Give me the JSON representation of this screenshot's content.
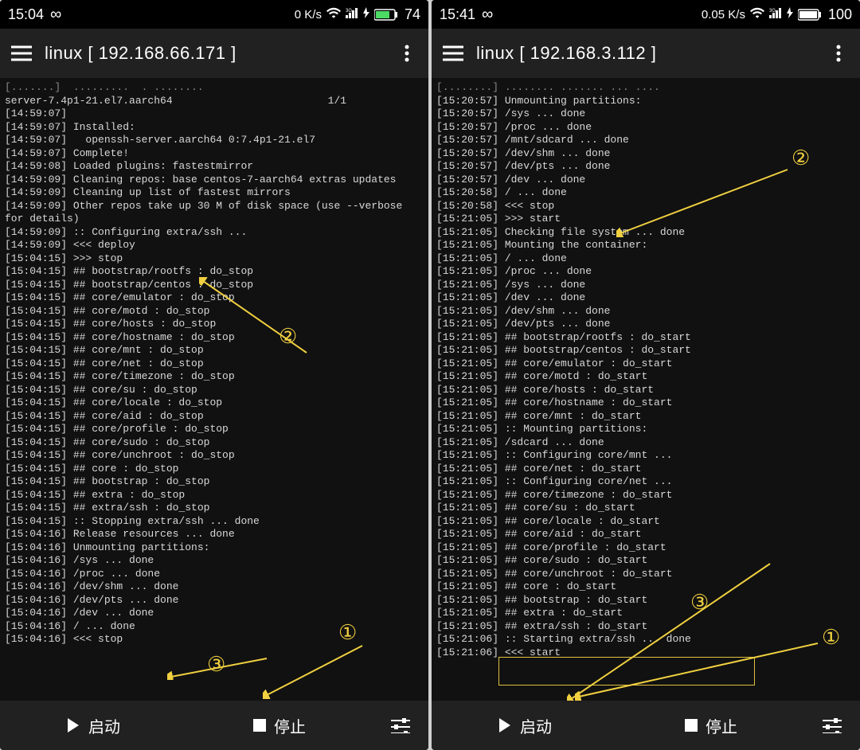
{
  "left": {
    "status": {
      "time": "15:04",
      "infinity": "∞",
      "speed": "0 K/s",
      "battery": "74"
    },
    "appbar": {
      "title": "linux  [ 192.168.66.171 ]"
    },
    "log": [
      "[.......]  .........  . ........",
      "server-7.4p1-21.el7.aarch64                         1/1",
      "[14:59:07]",
      "[14:59:07] Installed:",
      "[14:59:07]   openssh-server.aarch64 0:7.4p1-21.el7",
      "[14:59:07] Complete!",
      "[14:59:08] Loaded plugins: fastestmirror",
      "[14:59:09] Cleaning repos: base centos-7-aarch64 extras updates",
      "[14:59:09] Cleaning up list of fastest mirrors",
      "[14:59:09] Other repos take up 30 M of disk space (use --verbose for details)",
      "[14:59:09] :: Configuring extra/ssh ...",
      "[14:59:09] <<< deploy",
      "[15:04:15] >>> stop",
      "[15:04:15] ## bootstrap/rootfs : do_stop",
      "[15:04:15] ## bootstrap/centos : do_stop",
      "[15:04:15] ## core/emulator : do_stop",
      "[15:04:15] ## core/motd : do_stop",
      "[15:04:15] ## core/hosts : do_stop",
      "[15:04:15] ## core/hostname : do_stop",
      "[15:04:15] ## core/mnt : do_stop",
      "[15:04:15] ## core/net : do_stop",
      "[15:04:15] ## core/timezone : do_stop",
      "[15:04:15] ## core/su : do_stop",
      "[15:04:15] ## core/locale : do_stop",
      "[15:04:15] ## core/aid : do_stop",
      "[15:04:15] ## core/profile : do_stop",
      "[15:04:15] ## core/sudo : do_stop",
      "[15:04:15] ## core/unchroot : do_stop",
      "[15:04:15] ## core : do_stop",
      "[15:04:15] ## bootstrap : do_stop",
      "[15:04:15] ## extra : do_stop",
      "[15:04:15] ## extra/ssh : do_stop",
      "[15:04:15] :: Stopping extra/ssh ... done",
      "[15:04:16] Release resources ... done",
      "[15:04:16] Unmounting partitions:",
      "[15:04:16] /sys ... done",
      "[15:04:16] /proc ... done",
      "[15:04:16] /dev/shm ... done",
      "[15:04:16] /dev/pts ... done",
      "[15:04:16] /dev ... done",
      "[15:04:16] / ... done",
      "[15:04:16] <<< stop"
    ],
    "bottom": {
      "start": "启动",
      "stop": "停止"
    },
    "annot": {
      "n1": "①",
      "n2": "②",
      "n3": "③"
    }
  },
  "right": {
    "status": {
      "time": "15:41",
      "infinity": "∞",
      "speed": "0.05 K/s",
      "battery": "100"
    },
    "appbar": {
      "title": "linux  [ 192.168.3.112 ]"
    },
    "log": [
      "[........] ........ ....... ... ....",
      "[15:20:57] Unmounting partitions:",
      "[15:20:57] /sys ... done",
      "[15:20:57] /proc ... done",
      "[15:20:57] /mnt/sdcard ... done",
      "[15:20:57] /dev/shm ... done",
      "[15:20:57] /dev/pts ... done",
      "[15:20:57] /dev ... done",
      "[15:20:58] / ... done",
      "[15:20:58] <<< stop",
      "[15:21:05] >>> start",
      "[15:21:05] Checking file system ... done",
      "[15:21:05] Mounting the container:",
      "[15:21:05] / ... done",
      "[15:21:05] /proc ... done",
      "[15:21:05] /sys ... done",
      "[15:21:05] /dev ... done",
      "[15:21:05] /dev/shm ... done",
      "[15:21:05] /dev/pts ... done",
      "[15:21:05] ## bootstrap/rootfs : do_start",
      "[15:21:05] ## bootstrap/centos : do_start",
      "[15:21:05] ## core/emulator : do_start",
      "[15:21:05] ## core/motd : do_start",
      "[15:21:05] ## core/hosts : do_start",
      "[15:21:05] ## core/hostname : do_start",
      "[15:21:05] ## core/mnt : do_start",
      "[15:21:05] :: Mounting partitions:",
      "[15:21:05] /sdcard ... done",
      "[15:21:05] :: Configuring core/mnt ...",
      "[15:21:05] ## core/net : do_start",
      "[15:21:05] :: Configuring core/net ...",
      "[15:21:05] ## core/timezone : do_start",
      "[15:21:05] ## core/su : do_start",
      "[15:21:05] ## core/locale : do_start",
      "[15:21:05] ## core/aid : do_start",
      "[15:21:05] ## core/profile : do_start",
      "[15:21:05] ## core/sudo : do_start",
      "[15:21:05] ## core/unchroot : do_start",
      "[15:21:05] ## core : do_start",
      "[15:21:05] ## bootstrap : do_start",
      "[15:21:05] ## extra : do_start",
      "[15:21:05] ## extra/ssh : do_start",
      "[15:21:06] :: Starting extra/ssh ... done",
      "[15:21:06] <<< start"
    ],
    "bottom": {
      "start": "启动",
      "stop": "停止"
    },
    "annot": {
      "n1": "①",
      "n2": "②",
      "n3": "③"
    }
  }
}
